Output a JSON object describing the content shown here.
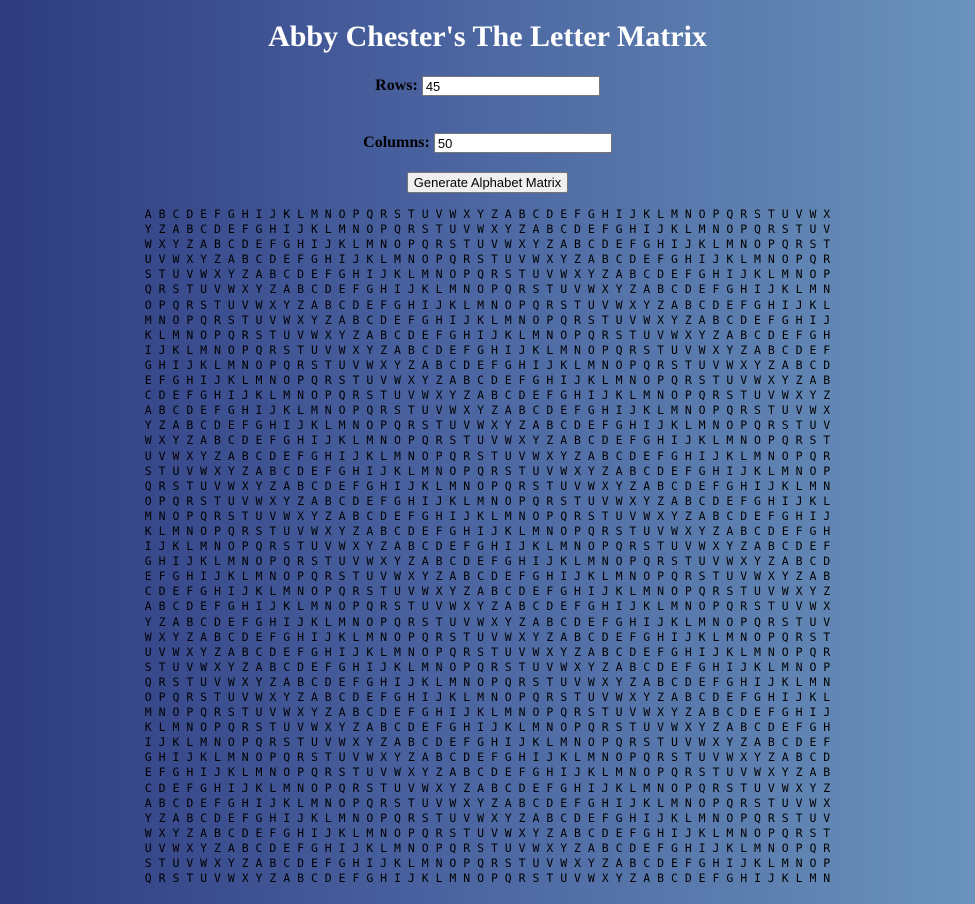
{
  "page": {
    "title": "Abby Chester's The Letter Matrix"
  },
  "form": {
    "rows_label": "Rows:",
    "rows_value": "45",
    "columns_label": "Columns:",
    "columns_value": "50",
    "generate_button_label": "Generate Alphabet Matrix"
  },
  "matrix": {
    "rows": [
      "A B C D E F G H I J K L M N O P Q R S T U V W X Y Z A B C D E F G H I J K L M N O P Q R S T U V W X",
      "Y Z A B C D E F G H I J K L M N O P Q R S T U V W X Y Z A B C D E F G H I J K L M N O P Q R S T U V",
      "W X Y Z A B C D E F G H I J K L M N O P Q R S T U V W X Y Z A B C D E F G H I J K L M N O P Q R S T",
      "U V W X Y Z A B C D E F G H I J K L M N O P Q R S T U V W X Y Z A B C D E F G H I J K L M N O P Q R",
      "S T U V W X Y Z A B C D E F G H I J K L M N O P Q R S T U V W X Y Z A B C D E F G H I J K L M N O P",
      "Q R S T U V W X Y Z A B C D E F G H I J K L M N O P Q R S T U V W X Y Z A B C D E F G H I J K L M N",
      "O P Q R S T U V W X Y Z A B C D E F G H I J K L M N O P Q R S T U V W X Y Z A B C D E F G H I J K L",
      "M N O P Q R S T U V W X Y Z A B C D E F G H I J K L M N O P Q R S T U V W X Y Z A B C D E F G H I J",
      "K L M N O P Q R S T U V W X Y Z A B C D E F G H I J K L M N O P Q R S T U V W X Y Z A B C D E F G H",
      "I J K L M N O P Q R S T U V W X Y Z A B C D E F G H I J K L M N O P Q R S T U V W X Y Z A B C D E F",
      "G H I J K L M N O P Q R S T U V W X Y Z A B C D E F G H I J K L M N O P Q R S T U V W X Y Z A B C D",
      "E F G H I J K L M N O P Q R S T U V W X Y Z A B C D E F G H I J K L M N O P Q R S T U V W X Y Z A B",
      "C D E F G H I J K L M N O P Q R S T U V W X Y Z A B C D E F G H I J K L M N O P Q R S T U V W X Y Z",
      "A B C D E F G H I J K L M N O P Q R S T U V W X Y Z A B C D E F G H I J K L M N O P Q R S T U V W X",
      "Y Z A B C D E F G H I J K L M N O P Q R S T U V W X Y Z A B C D E F G H I J K L M N O P Q R S T U V",
      "W X Y Z A B C D E F G H I J K L M N O P Q R S T U V W X Y Z A B C D E F G H I J K L M N O P Q R S T",
      "U V W X Y Z A B C D E F G H I J K L M N O P Q R S T U V W X Y Z A B C D E F G H I J K L M N O P Q R",
      "S T U V W X Y Z A B C D E F G H I J K L M N O P Q R S T U V W X Y Z A B C D E F G H I J K L M N O P",
      "Q R S T U V W X Y Z A B C D E F G H I J K L M N O P Q R S T U V W X Y Z A B C D E F G H I J K L M N",
      "O P Q R S T U V W X Y Z A B C D E F G H I J K L M N O P Q R S T U V W X Y Z A B C D E F G H I J K L",
      "M N O P Q R S T U V W X Y Z A B C D E F G H I J K L M N O P Q R S T U V W X Y Z A B C D E F G H I J",
      "K L M N O P Q R S T U V W X Y Z A B C D E F G H I J K L M N O P Q R S T U V W X Y Z A B C D E F G H",
      "I J K L M N O P Q R S T U V W X Y Z A B C D E F G H I J K L M N O P Q R S T U V W X Y Z A B C D E F",
      "G H I J K L M N O P Q R S T U V W X Y Z A B C D E F G H I J K L M N O P Q R S T U V W X Y Z A B C D",
      "E F G H I J K L M N O P Q R S T U V W X Y Z A B C D E F G H I J K L M N O P Q R S T U V W X Y Z A B",
      "C D E F G H I J K L M N O P Q R S T U V W X Y Z A B C D E F G H I J K L M N O P Q R S T U V W X Y Z",
      "A B C D E F G H I J K L M N O P Q R S T U V W X Y Z A B C D E F G H I J K L M N O P Q R S T U V W X",
      "Y Z A B C D E F G H I J K L M N O P Q R S T U V W X Y Z A B C D E F G H I J K L M N O P Q R S T U V",
      "W X Y Z A B C D E F G H I J K L M N O P Q R S T U V W X Y Z A B C D E F G H I J K L M N O P Q R S T",
      "U V W X Y Z A B C D E F G H I J K L M N O P Q R S T U V W X Y Z A B C D E F G H I J K L M N O P Q R",
      "S T U V W X Y Z A B C D E F G H I J K L M N O P Q R S T U V W X Y Z A B C D E F G H I J K L M N O P",
      "Q R S T U V W X Y Z A B C D E F G H I J K L M N O P Q R S T U V W X Y Z A B C D E F G H I J K L M N",
      "O P Q R S T U V W X Y Z A B C D E F G H I J K L M N O P Q R S T U V W X Y Z A B C D E F G H I J K L",
      "M N O P Q R S T U V W X Y Z A B C D E F G H I J K L M N O P Q R S T U V W X Y Z A B C D E F G H I J",
      "K L M N O P Q R S T U V W X Y Z A B C D E F G H I J K L M N O P Q R S T U V W X Y Z A B C D E F G H",
      "I J K L M N O P Q R S T U V W X Y Z A B C D E F G H I J K L M N O P Q R S T U V W X Y Z A B C D E F",
      "G H I J K L M N O P Q R S T U V W X Y Z A B C D E F G H I J K L M N O P Q R S T U V W X Y Z A B C D",
      "E F G H I J K L M N O P Q R S T U V W X Y Z A B C D E F G H I J K L M N O P Q R S T U V W X Y Z A B",
      "C D E F G H I J K L M N O P Q R S T U V W X Y Z A B C D E F G H I J K L M N O P Q R S T U V W X Y Z",
      "A B C D E F G H I J K L M N O P Q R S T U V W X Y Z A B C D E F G H I J K L M N O P Q R S T U V W X",
      "Y Z A B C D E F G H I J K L M N O P Q R S T U V W X Y Z A B C D E F G H I J K L M N O P Q R S T U V",
      "W X Y Z A B C D E F G H I J K L M N O P Q R S T U V W X Y Z A B C D E F G H I J K L M N O P Q R S T",
      "U V W X Y Z A B C D E F G H I J K L M N O P Q R S T U V W X Y Z A B C D E F G H I J K L M N O P Q R",
      "S T U V W X Y Z A B C D E F G H I J K L M N O P Q R S T U V W X Y Z A B C D E F G H I J K L M N O P",
      "Q R S T U V W X Y Z A B C D E F G H I J K L M N O P Q R S T U V W X Y Z A B C D E F G H I J K L M N"
    ]
  }
}
